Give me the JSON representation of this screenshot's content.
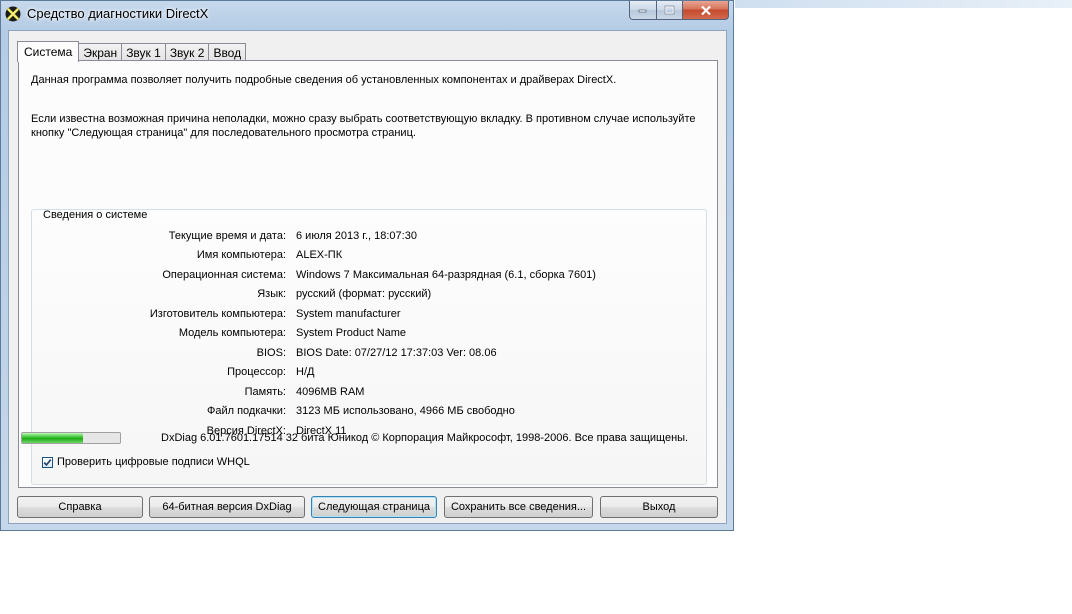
{
  "window": {
    "title": "Средство диагностики DirectX",
    "icon": "directx-icon"
  },
  "tabs": [
    {
      "label": "Система",
      "active": true
    },
    {
      "label": "Экран",
      "active": false
    },
    {
      "label": "Звук 1",
      "active": false
    },
    {
      "label": "Звук 2",
      "active": false
    },
    {
      "label": "Ввод",
      "active": false
    }
  ],
  "intro": {
    "line1": "Данная программа позволяет получить подробные сведения об установленных компонентах и драйверах DirectX.",
    "line2": "Если известна возможная причина неполадки, можно сразу выбрать соответствующую вкладку. В противном случае используйте кнопку \"Следующая страница\" для последовательного просмотра страниц."
  },
  "system_info": {
    "title": "Сведения о системе",
    "rows": [
      {
        "label": "Текущие время и дата:",
        "value": "6 июля 2013 г., 18:07:30"
      },
      {
        "label": "Имя компьютера:",
        "value": "ALEX-ПК"
      },
      {
        "label": "Операционная система:",
        "value": "Windows 7 Максимальная 64-разрядная (6.1, сборка 7601)"
      },
      {
        "label": "Язык:",
        "value": "русский (формат: русский)"
      },
      {
        "label": "Изготовитель компьютера:",
        "value": "System manufacturer"
      },
      {
        "label": "Модель компьютера:",
        "value": "System Product Name"
      },
      {
        "label": "BIOS:",
        "value": "BIOS Date: 07/27/12 17:37:03 Ver: 08.06"
      },
      {
        "label": "Процессор:",
        "value": "Н/Д"
      },
      {
        "label": "Память:",
        "value": "4096MB RAM"
      },
      {
        "label": "Файл подкачки:",
        "value": "3123 МБ использовано, 4966 МБ свободно"
      },
      {
        "label": "Версия DirectX:",
        "value": "DirectX 11"
      }
    ],
    "whql_label": "Проверить цифровые подписи WHQL",
    "whql_checked": true
  },
  "status": {
    "progress": 0.62,
    "progress_color": "#33c12a",
    "text": "DxDiag 6.01.7601.17514 32 бита Юникод  © Корпорация Майкрософт, 1998-2006.  Все права защищены."
  },
  "buttons": {
    "help": "Справка",
    "dxdiag64": "64-битная версия DxDiag",
    "next_page": "Следующая страница",
    "save_all": "Сохранить все сведения...",
    "exit": "Выход"
  }
}
